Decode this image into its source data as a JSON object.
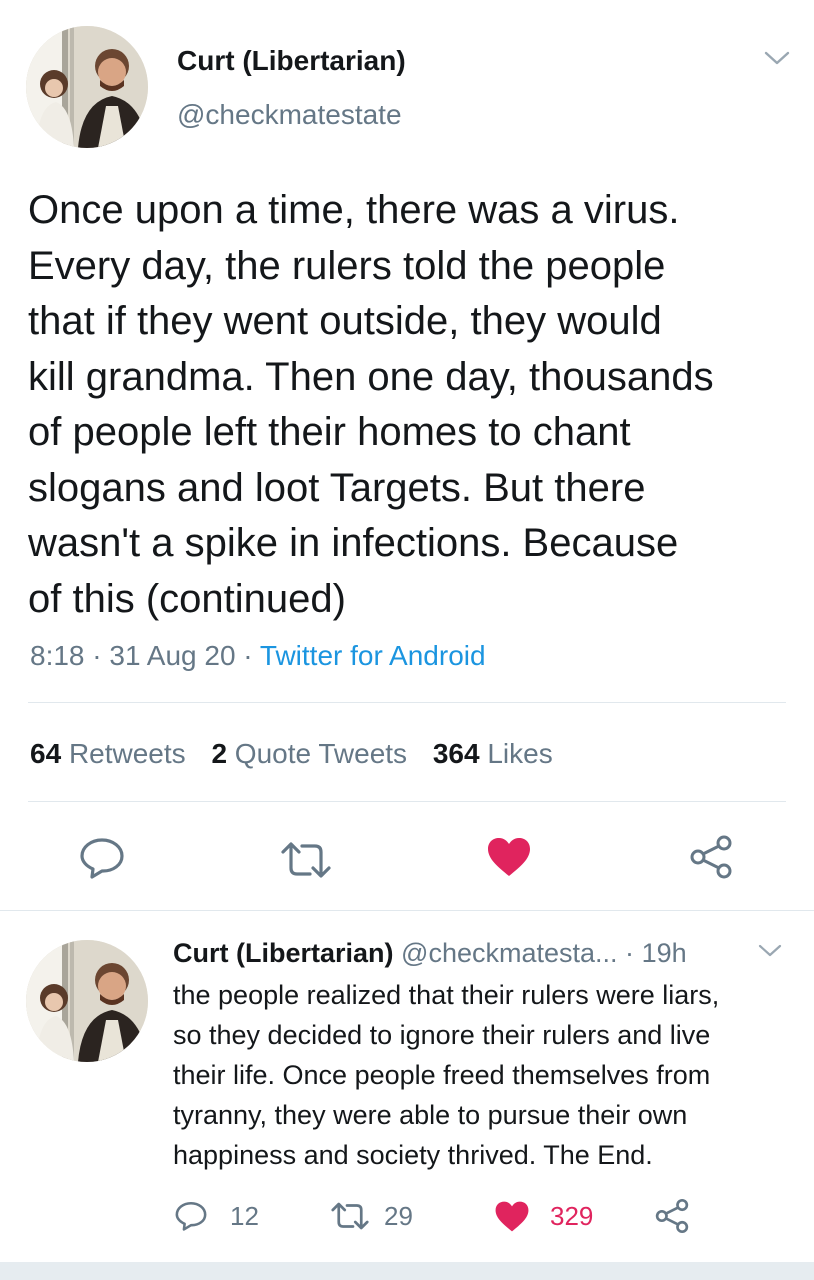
{
  "main_tweet": {
    "display_name": "Curt (Libertarian)",
    "handle": "@checkmatestate",
    "text": "Once upon a time, there was a virus.\nEvery day, the rulers told the people\nthat if they went outside, they would\nkill grandma. Then one day, thousands\nof people left their homes to chant\nslogans and loot Targets. But there\nwasn't a spike in infections. Because\nof this (continued)",
    "time": "8:18",
    "date": "31 Aug 20",
    "separator": "·",
    "source": "Twitter for Android",
    "stats": {
      "retweets_count": "64",
      "retweets_label": "Retweets",
      "quotes_count": "2",
      "quotes_label": "Quote Tweets",
      "likes_count": "364",
      "likes_label": "Likes"
    }
  },
  "reply_tweet": {
    "display_name": "Curt (Libertarian)",
    "handle": "@checkmatesta...",
    "separator": "·",
    "age": "19h",
    "text": "the people realized that their rulers were liars,\nso they decided to ignore their rulers and live\ntheir life. Once people freed themselves from\ntyranny, they were able to pursue their own\nhappiness and society thrived. The End.",
    "reply_count": "12",
    "retweet_count": "29",
    "like_count": "329"
  },
  "colors": {
    "like_red": "#e0245e",
    "icon_gray": "#657786",
    "link_blue": "#1b95e0",
    "divider": "#e1e8ed"
  },
  "icons": [
    "chevron-down-icon",
    "reply-icon",
    "retweet-icon",
    "heart-icon",
    "share-icon"
  ]
}
